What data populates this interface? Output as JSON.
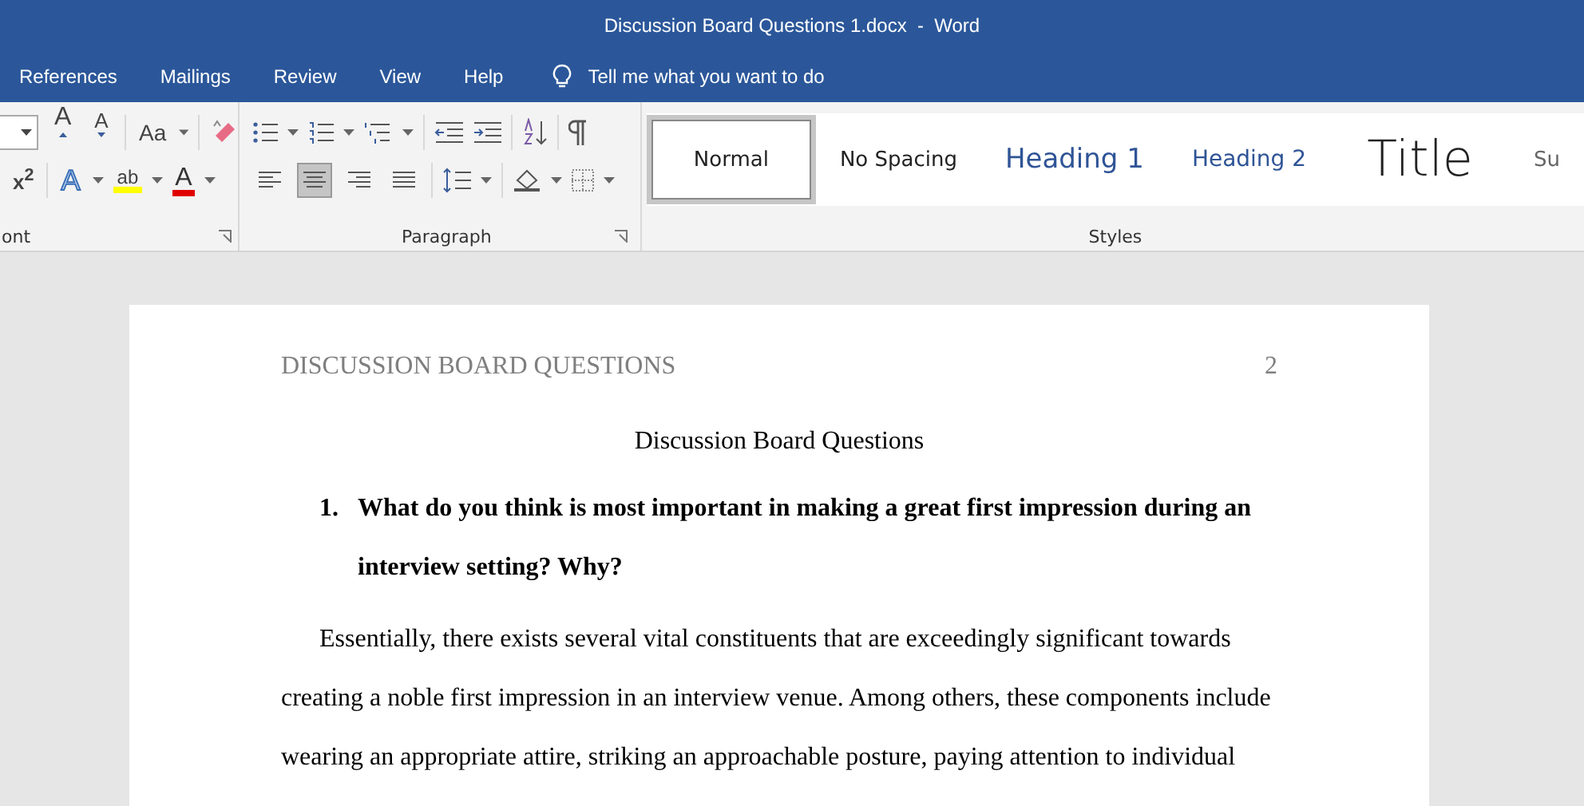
{
  "window": {
    "title": "Discussion Board Questions 1.docx  -  Word"
  },
  "tabs": [
    {
      "label": "References",
      "selected": false
    },
    {
      "label": "Mailings",
      "selected": false
    },
    {
      "label": "Review",
      "selected": false
    },
    {
      "label": "View",
      "selected": false
    },
    {
      "label": "Help",
      "selected": false
    }
  ],
  "tell_me": {
    "placeholder": "Tell me what you want to do"
  },
  "font_group": {
    "label": "ont",
    "change_case": "Aa",
    "superscript": "x$^{2}$",
    "text_effects": "A",
    "highlight": "ab",
    "font_color": "A",
    "grow": "A",
    "shrink": "A"
  },
  "paragraph_group": {
    "label": "Paragraph",
    "alignments": [
      {
        "kind": "left",
        "selected": false
      },
      {
        "kind": "center",
        "selected": true
      },
      {
        "kind": "right",
        "selected": false
      },
      {
        "kind": "justify",
        "selected": false
      }
    ]
  },
  "styles_group": {
    "label": "Styles",
    "styles": [
      {
        "name": "Normal",
        "kind": "normal",
        "selected": true
      },
      {
        "name": "No Spacing",
        "kind": "normal",
        "selected": false
      },
      {
        "name": "Heading 1",
        "kind": "heading1",
        "selected": false
      },
      {
        "name": "Heading 2",
        "kind": "heading2",
        "selected": false
      },
      {
        "name": "Title",
        "kind": "title",
        "selected": false
      },
      {
        "name": "Su",
        "kind": "subtitle",
        "selected": false
      }
    ]
  },
  "document": {
    "header": "DISCUSSION BOARD QUESTIONS",
    "page_number": "2",
    "title": "Discussion Board Questions",
    "questions": [
      {
        "number": "1.",
        "text": "What do you think is most important in making a great first impression during an interview setting? Why?"
      }
    ],
    "paragraph": "Essentially, there exists several vital constituents that are exceedingly significant towards creating a noble first impression in an interview venue. Among others, these components include wearing an appropriate attire, striking an approachable posture, paying attention to individual"
  }
}
